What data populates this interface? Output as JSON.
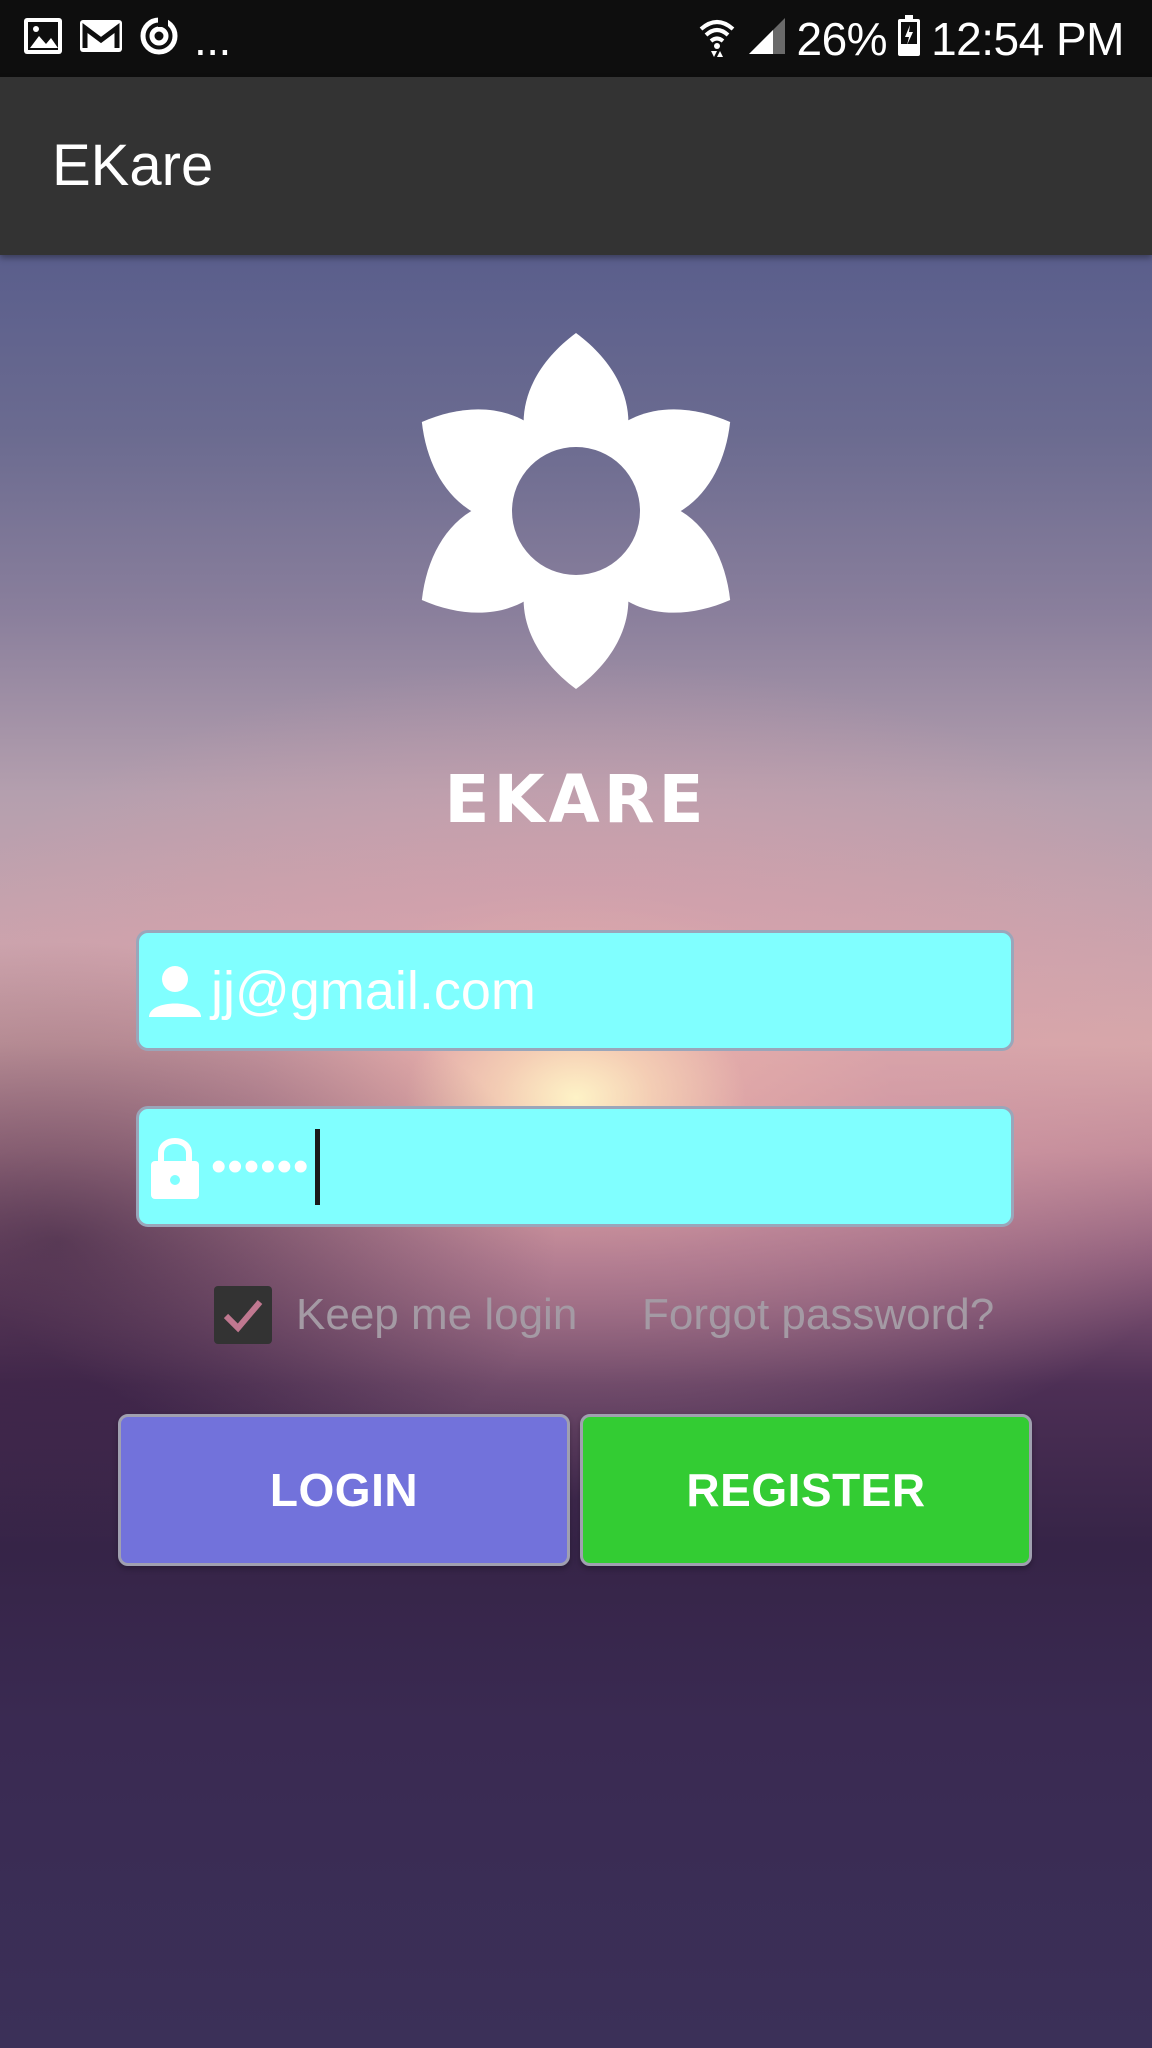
{
  "status_bar": {
    "left_icons": [
      "image-icon",
      "gmail-icon",
      "sync-icon"
    ],
    "overflow": "...",
    "battery": "26%",
    "time": "12:54 PM",
    "right_icons": [
      "wifi-icon",
      "signal-icon",
      "battery-icon"
    ]
  },
  "app_bar": {
    "title": "EKare"
  },
  "brand": {
    "logo": "flower-icon",
    "name": "EKARE"
  },
  "login_form": {
    "email": {
      "value": "jj@gmail.com",
      "icon": "user-icon"
    },
    "password": {
      "masked_value": "••••••",
      "icon": "lock-icon"
    },
    "keep_login": {
      "label": "Keep me login",
      "checked": true
    },
    "forgot_password": "Forgot password?",
    "login_label": "LOGIN",
    "register_label": "REGISTER"
  },
  "colors": {
    "app_bar": "#333333",
    "input_background": "#80ffff",
    "login_button": "#7272db",
    "register_button": "#33cc33"
  }
}
